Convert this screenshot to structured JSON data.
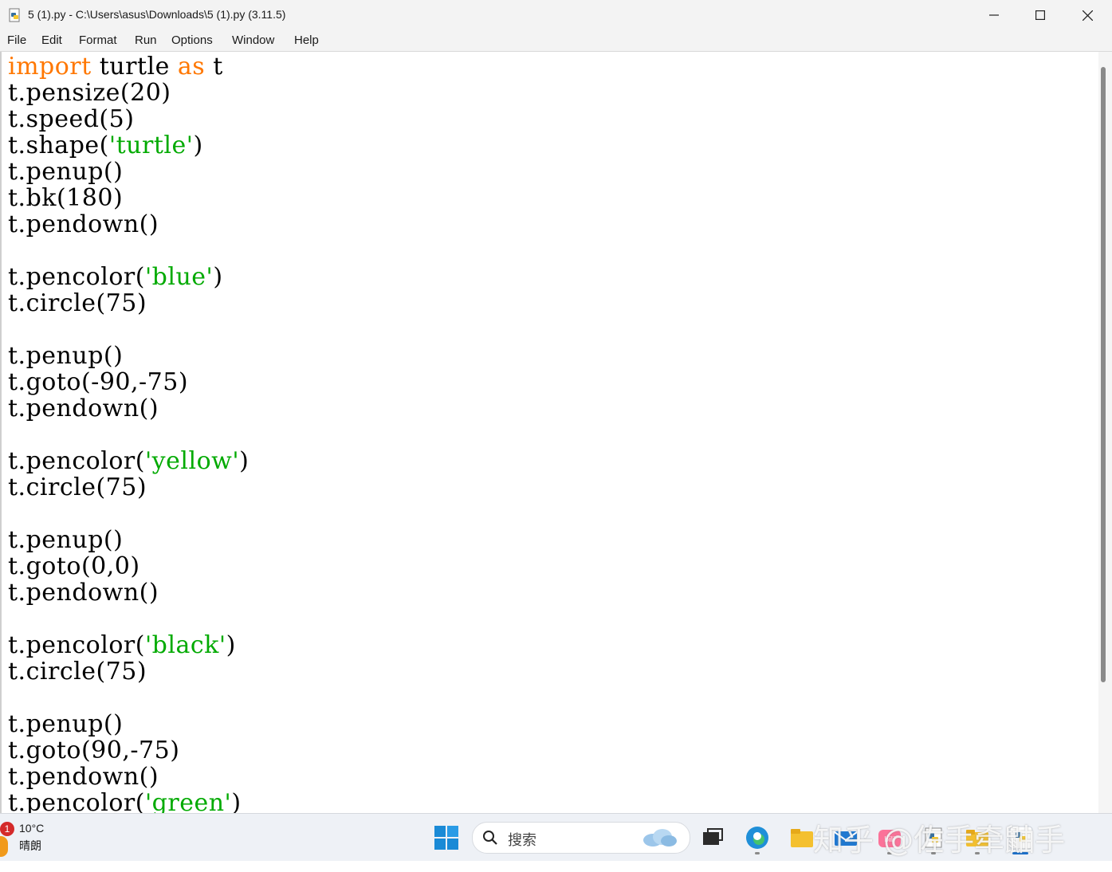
{
  "window": {
    "title": "5 (1).py - C:\\Users\\asus\\Downloads\\5 (1).py (3.11.5)",
    "minimize_icon": "minimize-icon",
    "maximize_icon": "maximize-icon",
    "close_icon": "close-icon"
  },
  "menu": [
    {
      "label": "File"
    },
    {
      "label": "Edit"
    },
    {
      "label": "Format"
    },
    {
      "label": "Run"
    },
    {
      "label": "Options"
    },
    {
      "label": "Window"
    },
    {
      "label": "Help"
    }
  ],
  "code": {
    "line1_kw1": "import",
    "line1_mid": " turtle ",
    "line1_kw2": "as",
    "line1_end": " t",
    "line2": "t.pensize(20)",
    "line3": "t.speed(5)",
    "line4_pre": "t.shape(",
    "line4_str": "'turtle'",
    "line4_post": ")",
    "line5": "t.penup()",
    "line6": "t.bk(180)",
    "line7": "t.pendown()",
    "line9_pre": "t.pencolor(",
    "line9_str": "'blue'",
    "line9_post": ")",
    "line10": "t.circle(75)",
    "line12": "t.penup()",
    "line13": "t.goto(-90,-75)",
    "line14": "t.pendown()",
    "line16_pre": "t.pencolor(",
    "line16_str": "'yellow'",
    "line16_post": ")",
    "line17": "t.circle(75)",
    "line19": "t.penup()",
    "line20": "t.goto(0,0)",
    "line21": "t.pendown()",
    "line23_pre": "t.pencolor(",
    "line23_str": "'black'",
    "line23_post": ")",
    "line24": "t.circle(75)",
    "line26": "t.penup()",
    "line27": "t.goto(90,-75)",
    "line28": "t.pendown()",
    "line29_pre": "t.pencolor(",
    "line29_str": "'green'",
    "line29_post": ")"
  },
  "colors": {
    "keyword": "#ff7700",
    "string": "#00aa00"
  },
  "taskbar": {
    "weather_badge": "1",
    "temperature": "10°C",
    "condition": "晴朗",
    "search_placeholder": "搜索",
    "watermark": "知乎 @佐手牵鼬手"
  }
}
